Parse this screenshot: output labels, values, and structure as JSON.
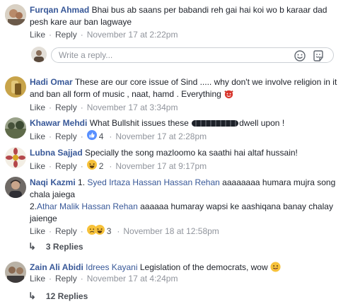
{
  "comments": [
    {
      "name": "Furqan Ahmad",
      "text": "Bhai bus ab saans per babandi reh gai hai koi wo b karaar dad pesh kare aur ban lagwaye",
      "like": "Like",
      "reply": "Reply",
      "time": "November 17 at 2:22pm"
    },
    {
      "name": "Hadi Omar",
      "text": "These are our core issue of Sind ..... why don't we involve religion in it and ban all form of music , naat, hamd . Everything",
      "like": "Like",
      "reply": "Reply",
      "time": "November 17 at 3:34pm"
    },
    {
      "name": "Khawar Mehdi",
      "text_before": "What Bullshit issues these",
      "text_after": "dwell upon !",
      "like": "Like",
      "reply": "Reply",
      "reaction_count": "4",
      "time": "November 17 at 2:28pm"
    },
    {
      "name": "Lubna Sajjad",
      "text": "Specially the song mazloomo ka saathi hai altaf hussain!",
      "like": "Like",
      "reply": "Reply",
      "reaction_count": "2",
      "time": "November 17 at 9:17pm"
    },
    {
      "name": "Naqi Kazmi",
      "line1_prefix": "1.",
      "mention1": "Syed Irtaza Hassan Hassan Rehan",
      "line1_text": "aaaaaaaa humara mujra song chala jaiega",
      "line2_prefix": "2.",
      "mention2": "Athar Malik Hassan Rehan",
      "line2_text": "aaaaaa humaray wapsi ke aashiqana banay chalay jaienge",
      "like": "Like",
      "reply": "Reply",
      "reaction_count": "3",
      "time": "November 18 at 12:58pm",
      "replies": "3 Replies"
    },
    {
      "name": "Zain Ali Abidi",
      "mention": "Idrees Kayani",
      "text": "Legislation of the democrats, wow",
      "like": "Like",
      "reply": "Reply",
      "time": "November 17 at 4:24pm",
      "replies": "12 Replies"
    }
  ],
  "reply_box": {
    "placeholder": "Write a reply..."
  },
  "separator": "·",
  "colors": {
    "link": "#385898",
    "meta": "#90949c",
    "like_blue": "#5890ff",
    "emoji_yellow": "#f7c23a"
  },
  "icons": [
    "emoji-icon",
    "sticker-icon",
    "like-reaction-icon",
    "laugh-reaction-icon",
    "devil-emoji-icon",
    "tongue-emoji-icon"
  ]
}
